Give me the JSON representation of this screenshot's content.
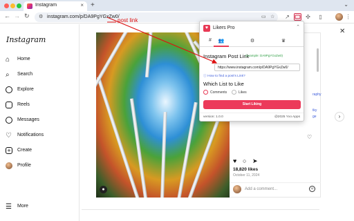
{
  "browser": {
    "tab_title": "Instagram",
    "tab_close": "×",
    "new_tab": "+",
    "tab_menu": "⌄",
    "url": "instagram.com/p/DA9PgYGxZw0/",
    "nav_back": "←",
    "nav_forward": "→",
    "nav_reload": "↻",
    "traffic_lights": [
      "#ff5f57",
      "#febc2e",
      "#28c840"
    ]
  },
  "annotation": {
    "label": "post link",
    "color": "#dd1111"
  },
  "instagram": {
    "logo": "Instagram",
    "nav": [
      {
        "label": "Home",
        "icon": "home-icon"
      },
      {
        "label": "Search",
        "icon": "search-icon"
      },
      {
        "label": "Explore",
        "icon": "explore-icon"
      },
      {
        "label": "Reels",
        "icon": "reels-icon"
      },
      {
        "label": "Messages",
        "icon": "messages-icon"
      },
      {
        "label": "Notifications",
        "icon": "heart-icon"
      },
      {
        "label": "Create",
        "icon": "plus-icon"
      },
      {
        "label": "Profile",
        "icon": "avatar-icon"
      }
    ],
    "more": "More",
    "post": {
      "likes": "18,820 likes",
      "date": "October 11, 2024",
      "comment_placeholder": "Add a comment...",
      "caption_fragments": [
        "raphy",
        "tky",
        "ge"
      ]
    }
  },
  "extension": {
    "title": "Likers Pro",
    "tabs": [
      "#",
      "👥",
      "⚙",
      "♛"
    ],
    "selected_tab_index": 1,
    "post_link_label": "Instagram Post Link",
    "post_link_example": "(example: DA9PgYGxZw0)",
    "post_link_value": "https://www.instagram.com/p/DA9PgYGxZw0/",
    "howto_link": "How to find a post's Link?",
    "list_label": "Which List to Like",
    "options": [
      "Comments",
      "Likes"
    ],
    "selected_option": "Comments",
    "start_button": "Start Liking",
    "version": "version: 1.0.0",
    "copyright": "@2025 Yxo Apps",
    "accent_color": "#ec3a5a"
  }
}
